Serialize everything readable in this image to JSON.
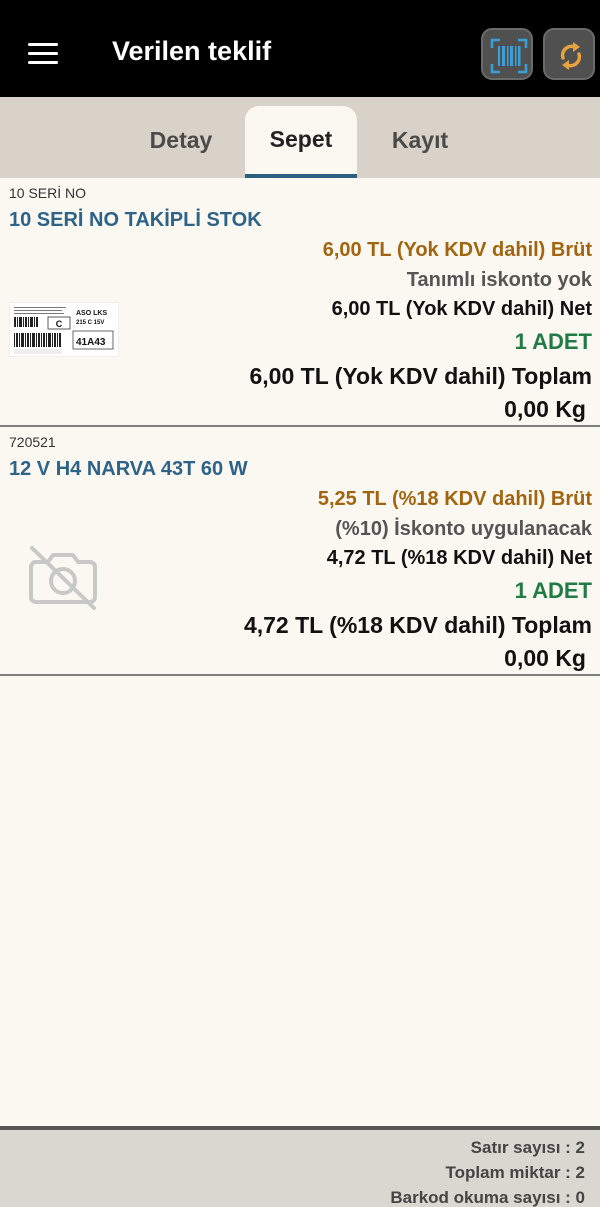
{
  "header": {
    "title": "Verilen teklif",
    "icons": {
      "menu": "menu-icon",
      "barcode": "barcode-scan-icon",
      "refresh": "refresh-icon"
    },
    "colors": {
      "bar": "#000000",
      "barcode_icon": "#3aa0d8",
      "refresh_icon": "#e6a23c"
    }
  },
  "tabs": [
    {
      "label": "Detay"
    },
    {
      "label": "Sepet",
      "selected": true
    },
    {
      "label": "Kayıt"
    }
  ],
  "items": [
    {
      "code": "10 SERİ NO",
      "name": "10 SERİ NO TAKİPLİ STOK",
      "brut": "6,00 TL (Yok KDV dahil) Brüt",
      "discount": "Tanımlı iskonto yok",
      "net": "6,00 TL (Yok KDV dahil) Net",
      "quantity": "1 ADET",
      "total": "6,00 TL (Yok KDV dahil) Toplam",
      "weight": "0,00 Kg",
      "image": {
        "type": "barcode-label",
        "text_line1": "ASO LKS",
        "text_line2": "215 C 15V",
        "letter": "C",
        "code": "41A43"
      }
    },
    {
      "code": "720521",
      "name": "12 V  H4 NARVA 43T 60 W",
      "brut": "5,25 TL (%18 KDV dahil) Brüt",
      "discount": "(%10) İskonto uygulanacak",
      "net": "4,72 TL (%18 KDV dahil) Net",
      "quantity": "1 ADET",
      "total": "4,72 TL (%18 KDV dahil) Toplam",
      "weight": "0,00 Kg",
      "image": {
        "type": "no-photo-icon"
      }
    }
  ],
  "footer": {
    "row_count": "Satır sayısı : 2",
    "total_quantity": "Toplam miktar : 2",
    "barcode_reads": "Barkod okuma sayısı : 0"
  }
}
